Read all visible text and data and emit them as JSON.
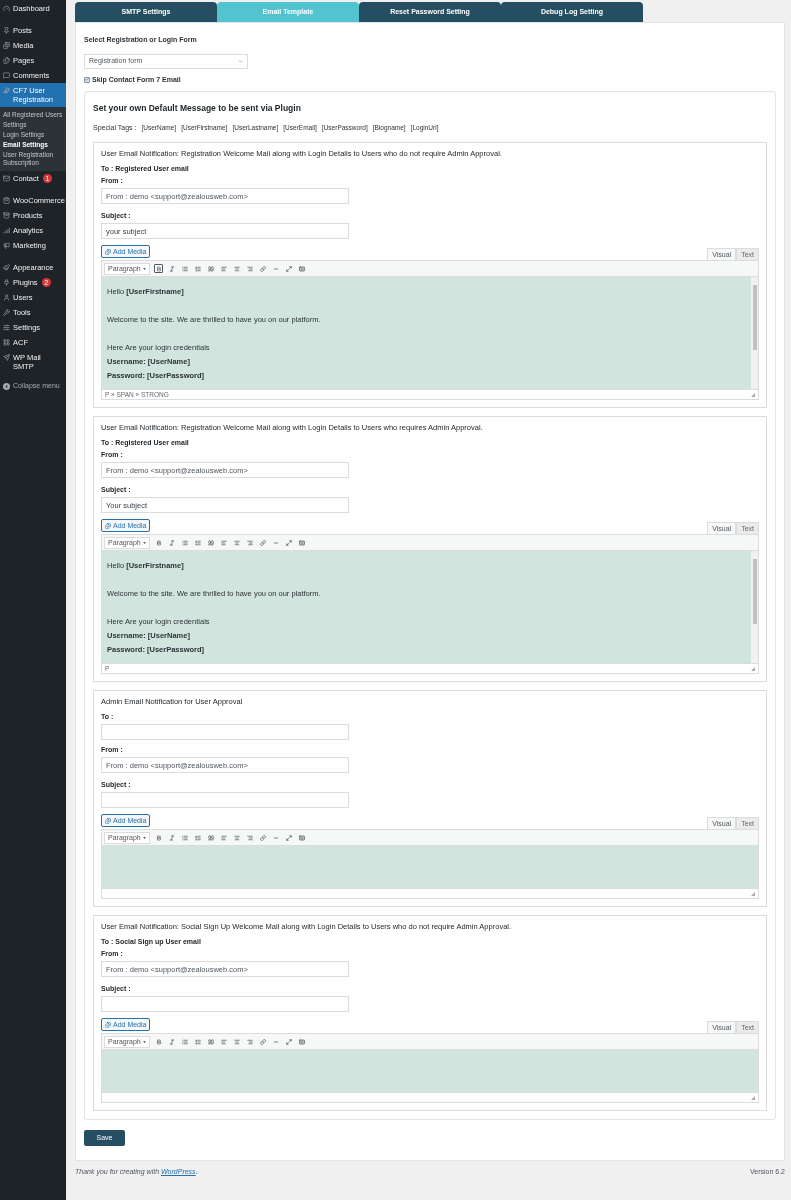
{
  "sidebar": {
    "groups": [
      [
        {
          "label": "Dashboard",
          "selected": false
        }
      ],
      [
        {
          "label": "Posts",
          "selected": false
        },
        {
          "label": "Media",
          "selected": false
        },
        {
          "label": "Pages",
          "selected": false
        },
        {
          "label": "Comments",
          "selected": false
        },
        {
          "label": "CF7 User Registration",
          "selected": true,
          "children": [
            {
              "label": "All Registered Users",
              "selected": false
            },
            {
              "label": "Settings",
              "selected": false
            },
            {
              "label": "Login Settings",
              "selected": false
            },
            {
              "label": "Email Settings",
              "selected": true
            },
            {
              "label": "User Registration Subscription",
              "selected": false
            }
          ]
        },
        {
          "label": "Contact",
          "selected": false,
          "badge": "1"
        }
      ],
      [
        {
          "label": "WooCommerce",
          "selected": false
        },
        {
          "label": "Products",
          "selected": false
        },
        {
          "label": "Analytics",
          "selected": false
        },
        {
          "label": "Marketing",
          "selected": false
        }
      ],
      [
        {
          "label": "Appearance",
          "selected": false
        },
        {
          "label": "Plugins",
          "selected": false,
          "badge": "2"
        },
        {
          "label": "Users",
          "selected": false
        },
        {
          "label": "Tools",
          "selected": false
        },
        {
          "label": "Settings",
          "selected": false
        },
        {
          "label": "ACF",
          "selected": false
        },
        {
          "label": "WP Mail SMTP",
          "selected": false
        }
      ]
    ],
    "collapse": "Collapse menu"
  },
  "tabs": [
    {
      "label": "SMTP Settings",
      "selected": false
    },
    {
      "label": "Email Template",
      "selected": true
    },
    {
      "label": "Reset Password Setting",
      "selected": false
    },
    {
      "label": "Debug Log Setting",
      "selected": false
    }
  ],
  "form": {
    "select_label": "Select Registration or Login Form",
    "select_value": "Registration form",
    "skip": {
      "label": "Skip Contact Form 7 Email",
      "checked": true
    }
  },
  "panel": {
    "heading": "Set your own Default Message to be sent via Plugin",
    "tags_label": "Special Tags :",
    "tags": [
      "[UserName]",
      "[UserFirstname]",
      "[UserLastname]",
      "[UserEmail]",
      "[UserPassword]",
      "[Blogname]",
      "[LoginUrl]"
    ]
  },
  "sections": [
    {
      "title": "User Email Notification: Registration Welcome Mail along with Login Details to Users who do not require Admin Approval.",
      "to": {
        "kind": "text",
        "text": "To : Registered User email"
      },
      "from": {
        "label": "From :",
        "placeholder": "From : demo <support@zealousweb.com>"
      },
      "subject": {
        "label": "Subject :",
        "value": "your subject"
      },
      "editor": {
        "add_media": "Add Media",
        "tabs": [
          {
            "label": "Visual",
            "selected": true
          },
          {
            "label": "Text",
            "selected": false
          }
        ],
        "format": "Paragraph",
        "bold_active": true,
        "path": "P » SPAN » STRONG",
        "paragraphs": [
          [
            {
              "text": "Hello **[UserFirstname]**",
              "bold": false
            }
          ],
          [
            {
              "text": "Welcome to the site. We are thrilled to have you on our platform.",
              "bold": false
            }
          ],
          [
            {
              "text": "Here Are your login credentials",
              "bold": false
            },
            {
              "text": "Username: [UserName]",
              "bold": true
            },
            {
              "text": "Password: [UserPassword]",
              "bold": true
            }
          ]
        ]
      }
    },
    {
      "title": "User Email Notification: Registration Welcome Mail along with Login Details to Users who requires Admin Approval.",
      "to": {
        "kind": "text",
        "text": "To : Registered User email"
      },
      "from": {
        "label": "From :",
        "placeholder": "From : demo <support@zealousweb.com>"
      },
      "subject": {
        "label": "Subject :",
        "value": "Your subject"
      },
      "editor": {
        "add_media": "Add Media",
        "tabs": [
          {
            "label": "Visual",
            "selected": true
          },
          {
            "label": "Text",
            "selected": false
          }
        ],
        "format": "Paragraph",
        "bold_active": false,
        "path": "P",
        "paragraphs": [
          [
            {
              "text": "Hello **[UserFirstname]**",
              "bold": false
            }
          ],
          [
            {
              "text": "Welcome to the site. We are thrilled to have you on our platform.",
              "bold": false
            }
          ],
          [
            {
              "text": "Here Are your login credentials",
              "bold": false
            },
            {
              "text": "Username: [UserName]",
              "bold": true
            },
            {
              "text": "Password: [UserPassword]",
              "bold": true
            }
          ]
        ]
      }
    },
    {
      "title": "Admin Email Notification for User Approval",
      "to": {
        "kind": "field",
        "label": "To :"
      },
      "from": {
        "label": "From :",
        "placeholder": "From : demo <support@zealousweb.com>"
      },
      "subject": {
        "label": "Subject :"
      },
      "editor": {
        "add_media": "Add Media",
        "tabs": [
          {
            "label": "Visual",
            "selected": true
          },
          {
            "label": "Text",
            "selected": false
          }
        ],
        "format": "Paragraph",
        "bold_active": false
      }
    },
    {
      "title": "User Email Notification: Social Sign Up Welcome Mail along with Login Details to Users who do not require Admin Approval.",
      "to": {
        "kind": "text",
        "text": "To : Social Sign up User email"
      },
      "from": {
        "label": "From :",
        "placeholder": "From : demo <support@zealousweb.com>"
      },
      "subject": {
        "label": "Subject :"
      },
      "editor": {
        "add_media": "Add Media",
        "tabs": [
          {
            "label": "Visual",
            "selected": true
          },
          {
            "label": "Text",
            "selected": false
          }
        ],
        "format": "Paragraph",
        "bold_active": false
      }
    }
  ],
  "save": "Save",
  "footer": {
    "thanks": "Thank you for creating with",
    "link": "WordPress",
    "period": ".",
    "version": "Version 6.2"
  }
}
